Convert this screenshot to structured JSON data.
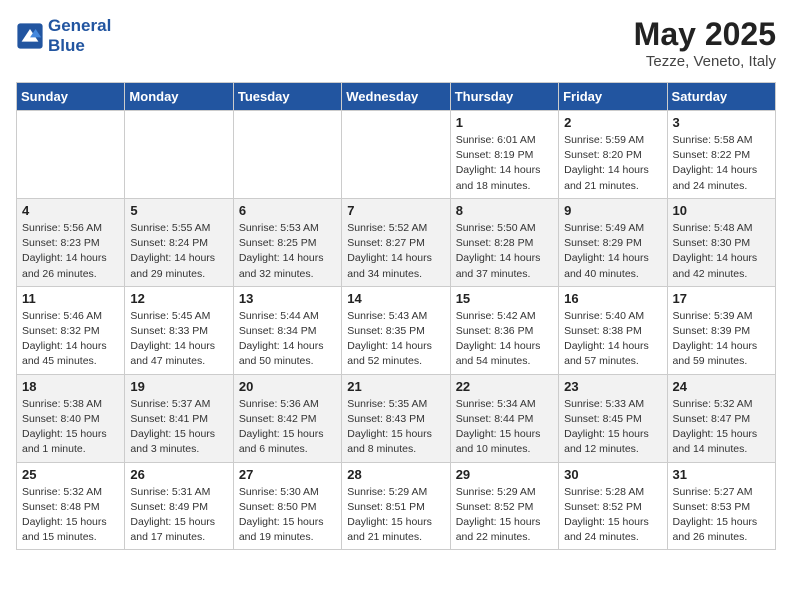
{
  "header": {
    "logo_line1": "General",
    "logo_line2": "Blue",
    "month": "May 2025",
    "location": "Tezze, Veneto, Italy"
  },
  "weekdays": [
    "Sunday",
    "Monday",
    "Tuesday",
    "Wednesday",
    "Thursday",
    "Friday",
    "Saturday"
  ],
  "weeks": [
    [
      {
        "day": "",
        "info": ""
      },
      {
        "day": "",
        "info": ""
      },
      {
        "day": "",
        "info": ""
      },
      {
        "day": "",
        "info": ""
      },
      {
        "day": "1",
        "info": "Sunrise: 6:01 AM\nSunset: 8:19 PM\nDaylight: 14 hours\nand 18 minutes."
      },
      {
        "day": "2",
        "info": "Sunrise: 5:59 AM\nSunset: 8:20 PM\nDaylight: 14 hours\nand 21 minutes."
      },
      {
        "day": "3",
        "info": "Sunrise: 5:58 AM\nSunset: 8:22 PM\nDaylight: 14 hours\nand 24 minutes."
      }
    ],
    [
      {
        "day": "4",
        "info": "Sunrise: 5:56 AM\nSunset: 8:23 PM\nDaylight: 14 hours\nand 26 minutes."
      },
      {
        "day": "5",
        "info": "Sunrise: 5:55 AM\nSunset: 8:24 PM\nDaylight: 14 hours\nand 29 minutes."
      },
      {
        "day": "6",
        "info": "Sunrise: 5:53 AM\nSunset: 8:25 PM\nDaylight: 14 hours\nand 32 minutes."
      },
      {
        "day": "7",
        "info": "Sunrise: 5:52 AM\nSunset: 8:27 PM\nDaylight: 14 hours\nand 34 minutes."
      },
      {
        "day": "8",
        "info": "Sunrise: 5:50 AM\nSunset: 8:28 PM\nDaylight: 14 hours\nand 37 minutes."
      },
      {
        "day": "9",
        "info": "Sunrise: 5:49 AM\nSunset: 8:29 PM\nDaylight: 14 hours\nand 40 minutes."
      },
      {
        "day": "10",
        "info": "Sunrise: 5:48 AM\nSunset: 8:30 PM\nDaylight: 14 hours\nand 42 minutes."
      }
    ],
    [
      {
        "day": "11",
        "info": "Sunrise: 5:46 AM\nSunset: 8:32 PM\nDaylight: 14 hours\nand 45 minutes."
      },
      {
        "day": "12",
        "info": "Sunrise: 5:45 AM\nSunset: 8:33 PM\nDaylight: 14 hours\nand 47 minutes."
      },
      {
        "day": "13",
        "info": "Sunrise: 5:44 AM\nSunset: 8:34 PM\nDaylight: 14 hours\nand 50 minutes."
      },
      {
        "day": "14",
        "info": "Sunrise: 5:43 AM\nSunset: 8:35 PM\nDaylight: 14 hours\nand 52 minutes."
      },
      {
        "day": "15",
        "info": "Sunrise: 5:42 AM\nSunset: 8:36 PM\nDaylight: 14 hours\nand 54 minutes."
      },
      {
        "day": "16",
        "info": "Sunrise: 5:40 AM\nSunset: 8:38 PM\nDaylight: 14 hours\nand 57 minutes."
      },
      {
        "day": "17",
        "info": "Sunrise: 5:39 AM\nSunset: 8:39 PM\nDaylight: 14 hours\nand 59 minutes."
      }
    ],
    [
      {
        "day": "18",
        "info": "Sunrise: 5:38 AM\nSunset: 8:40 PM\nDaylight: 15 hours\nand 1 minute."
      },
      {
        "day": "19",
        "info": "Sunrise: 5:37 AM\nSunset: 8:41 PM\nDaylight: 15 hours\nand 3 minutes."
      },
      {
        "day": "20",
        "info": "Sunrise: 5:36 AM\nSunset: 8:42 PM\nDaylight: 15 hours\nand 6 minutes."
      },
      {
        "day": "21",
        "info": "Sunrise: 5:35 AM\nSunset: 8:43 PM\nDaylight: 15 hours\nand 8 minutes."
      },
      {
        "day": "22",
        "info": "Sunrise: 5:34 AM\nSunset: 8:44 PM\nDaylight: 15 hours\nand 10 minutes."
      },
      {
        "day": "23",
        "info": "Sunrise: 5:33 AM\nSunset: 8:45 PM\nDaylight: 15 hours\nand 12 minutes."
      },
      {
        "day": "24",
        "info": "Sunrise: 5:32 AM\nSunset: 8:47 PM\nDaylight: 15 hours\nand 14 minutes."
      }
    ],
    [
      {
        "day": "25",
        "info": "Sunrise: 5:32 AM\nSunset: 8:48 PM\nDaylight: 15 hours\nand 15 minutes."
      },
      {
        "day": "26",
        "info": "Sunrise: 5:31 AM\nSunset: 8:49 PM\nDaylight: 15 hours\nand 17 minutes."
      },
      {
        "day": "27",
        "info": "Sunrise: 5:30 AM\nSunset: 8:50 PM\nDaylight: 15 hours\nand 19 minutes."
      },
      {
        "day": "28",
        "info": "Sunrise: 5:29 AM\nSunset: 8:51 PM\nDaylight: 15 hours\nand 21 minutes."
      },
      {
        "day": "29",
        "info": "Sunrise: 5:29 AM\nSunset: 8:52 PM\nDaylight: 15 hours\nand 22 minutes."
      },
      {
        "day": "30",
        "info": "Sunrise: 5:28 AM\nSunset: 8:52 PM\nDaylight: 15 hours\nand 24 minutes."
      },
      {
        "day": "31",
        "info": "Sunrise: 5:27 AM\nSunset: 8:53 PM\nDaylight: 15 hours\nand 26 minutes."
      }
    ]
  ]
}
